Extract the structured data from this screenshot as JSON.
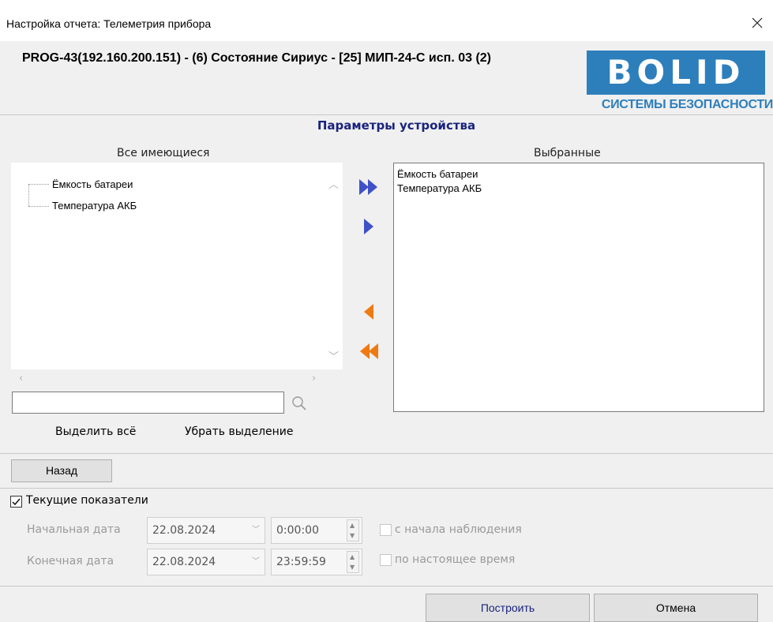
{
  "window": {
    "title": "Настройка отчета: Телеметрия прибора",
    "close_icon": "close-icon"
  },
  "header": {
    "device_path": "PROG-43(192.160.200.151) - (6) Состояние Сириус - [25] МИП-24-С исп. 03 (2)",
    "logo": {
      "word": "BOLID",
      "subtitle": "СИСТЕМЫ БЕЗОПАСНОСТИ",
      "brand_color": "#2d7fbc"
    }
  },
  "params": {
    "section_title": "Параметры устройства",
    "available_label": "Все имеющиеся",
    "selected_label": "Выбранные",
    "available_items": [
      "Ёмкость батареи",
      "Температура АКБ"
    ],
    "selected_items": [
      "Ёмкость батареи",
      "Температура АКБ"
    ],
    "search": {
      "value": "",
      "placeholder": ""
    },
    "select_all_label": "Выделить всё",
    "deselect_label": "Убрать выделение",
    "arrow_add_color": "#3f51c6",
    "arrow_remove_color": "#f07a12"
  },
  "nav": {
    "back_label": "Назад"
  },
  "options": {
    "current_values_label": "Текущие показатели",
    "current_values_checked": true,
    "start_date_label": "Начальная дата",
    "start_date": "22.08.2024",
    "start_time": "0:00:00",
    "from_beginning_label": "с начала наблюдения",
    "end_date_label": "Конечная дата",
    "end_date": "22.08.2024",
    "end_time": "23:59:59",
    "until_now_label": "по настоящее время"
  },
  "footer": {
    "build_label": "Построить",
    "cancel_label": "Отмена"
  }
}
